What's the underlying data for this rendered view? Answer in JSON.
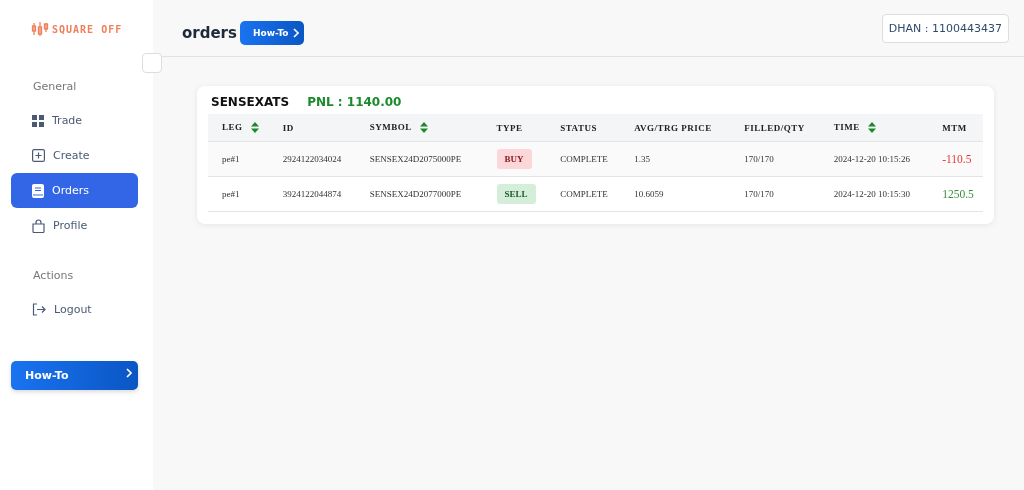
{
  "logo": {
    "text": "SQUARE OFF"
  },
  "sidebar": {
    "sections": [
      {
        "title": "General",
        "items": [
          {
            "label": "Trade",
            "kind": "grid",
            "selected": false
          },
          {
            "label": "Create",
            "kind": "plus",
            "selected": false
          },
          {
            "label": "Orders",
            "kind": "book",
            "selected": true
          },
          {
            "label": "Profile",
            "kind": "bag",
            "selected": false
          }
        ]
      },
      {
        "title": "Actions",
        "items": [
          {
            "label": "Logout",
            "kind": "logout",
            "selected": false
          }
        ]
      }
    ],
    "howto_button": {
      "label": "How-To"
    }
  },
  "header": {
    "title": "orders",
    "howto_button": {
      "label": "How-To"
    },
    "account": "DHAN : 1100443437"
  },
  "card": {
    "title": "SENSEXATS",
    "pnl": "PNL : 1140.00",
    "table": {
      "columns": [
        {
          "label": "LEG",
          "sortable": true
        },
        {
          "label": "ID",
          "sortable": false
        },
        {
          "label": "SYMBOL",
          "sortable": true
        },
        {
          "label": "TYPE",
          "sortable": false
        },
        {
          "label": "STATUS",
          "sortable": false
        },
        {
          "label": "AVG/TRG PRICE",
          "sortable": false
        },
        {
          "label": "FILLED/QTY",
          "sortable": false
        },
        {
          "label": "TIME",
          "sortable": true
        },
        {
          "label": "MTM",
          "sortable": false
        }
      ],
      "rows": [
        {
          "leg": "pe#1",
          "id": "2924122034024",
          "symbol": "SENSEX24D2075000PE",
          "type": {
            "label": "BUY",
            "kind": "buy"
          },
          "status": "COMPLETE",
          "price": "1.35",
          "filled": "170/170",
          "time": "2024-12-20 10:15:26",
          "mtm": {
            "text": "-110.5",
            "color": "#e53935"
          }
        },
        {
          "leg": "pe#1",
          "id": "3924122044874",
          "symbol": "SENSEX24D2077000PE",
          "type": {
            "label": "SELL",
            "kind": "sell"
          },
          "status": "COMPLETE",
          "price": "10.6059",
          "filled": "170/170",
          "time": "2024-12-20 10:15:30",
          "mtm": {
            "text": "1250.5",
            "color": "#388e3c"
          }
        }
      ]
    }
  }
}
